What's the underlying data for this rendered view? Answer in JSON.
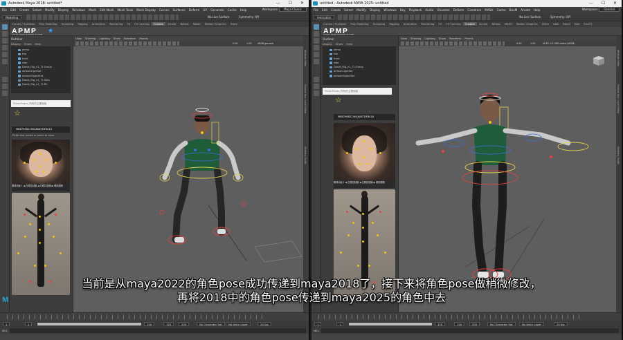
{
  "left_window": {
    "title": "Autodesk Maya 2018: untitled*",
    "menus": [
      "File",
      "Edit",
      "Create",
      "Select",
      "Modify",
      "Display",
      "Windows",
      "Mesh",
      "Edit Mesh",
      "Mesh Tools",
      "Mesh Display",
      "Curves",
      "Surfaces",
      "Deform",
      "UV",
      "Generate",
      "Cache",
      "Help"
    ],
    "workspace_label": "Workspace:",
    "workspace_value": "Maya Classic",
    "mode": "Modeling",
    "no_live": "No Live Surface",
    "symmetry": "Symmetry: Off",
    "shelf_tabs": [
      "Curves / Surfaces",
      "Poly Modeling",
      "Sculpting",
      "Rigging",
      "Animation",
      "Rendering",
      "FX",
      "FX Caching",
      "Custom",
      "Arnold",
      "Bifrost",
      "MASH",
      "Motion Graphics",
      "XGen"
    ],
    "active_shelf": "Custom",
    "outliner": {
      "title": "Outliner",
      "menu": [
        "Display",
        "Show",
        "Help"
      ],
      "rows": [
        "persp",
        "top",
        "front",
        "side",
        "Dandi_Rig_v1_71:Group",
        "defaultLightSet",
        "defaultObjectSet",
        "Dandi_Rig_v1_71:Sets",
        "Dandi_Rig_v1_71:Rh"
      ]
    },
    "picker_placeholder": "PickerPicker_所有的主要面板",
    "picker_bar": "MB87968225KAKA8TDFB418",
    "picker_desc": "Picker fast (select or select to close",
    "face_controls": "眼球动画  1   ◀ 左眼控制器  ◀ 右眼控制器  ▶ 眼睛跟随",
    "vp_menus": [
      "View",
      "Shading",
      "Lighting",
      "Show",
      "Renderer",
      "Panels"
    ],
    "vp_values": [
      "0.00",
      "1.00",
      "sRGB gamma"
    ],
    "range": {
      "start": "1",
      "frame": "1",
      "end_a": "120",
      "end_b": "120",
      "end_c": "200",
      "character": "No Character Set",
      "anim_layer": "No Anim Layer",
      "fps": "24 fps"
    },
    "mel": "MEL"
  },
  "right_window": {
    "title": "untitled - Autodesk MAYA 2025: untitled",
    "menus": [
      "File",
      "Edit",
      "Create",
      "Select",
      "Modify",
      "Display",
      "Windows",
      "Key",
      "Playback",
      "Audio",
      "Visualize",
      "Deform",
      "Constrain",
      "MASH",
      "Cache",
      "BeoM",
      "Arnold",
      "Help"
    ],
    "workspace_label": "Workspace:",
    "workspace_value": "General",
    "mode": "Animation",
    "no_live": "No Live Surface",
    "symmetry": "Symmetry: Off",
    "shelf_tabs": [
      "Curves / Surfaces",
      "Poly Modeling",
      "Sculpting",
      "Rigging",
      "Animation",
      "Rendering",
      "FX",
      "FX Caching",
      "Custom",
      "Arnold",
      "Bifrost",
      "MASH",
      "Motion Graphics",
      "XGen",
      "USD",
      "Bevel",
      "Edit",
      "FlexT3"
    ],
    "active_shelf": "Custom",
    "outliner": {
      "title": "Outliner",
      "menu": [
        "Display",
        "Show",
        "Help"
      ],
      "rows": [
        "persp",
        "top",
        "front",
        "side",
        "Dandi_Rig_v1_71:Group",
        "defaultLightSet",
        "defaultObjectSet"
      ]
    },
    "picker_placeholder": "PickerPicker_所有的主要面板",
    "picker_bar": "MB87968225KAKA8TDFB418",
    "picker_desc": "",
    "face_controls": "眼球动画  1   ◀ 左眼控制器  ◀ 右眼控制器  ▶ 眼睛跟随",
    "vp_menus": [
      "View",
      "Shading",
      "Lighting",
      "Show",
      "Renderer",
      "Panels"
    ],
    "vp_values": [
      "0.00",
      "1.00",
      "ACES 1.0 SDR-video (sRGB)"
    ],
    "camera_label": "persp",
    "range": {
      "start": "1",
      "frame": "1",
      "end_a": "120",
      "end_b": "120",
      "end_c": "200",
      "character": "No Character Set",
      "anim_layer": "No Anim Layer",
      "fps": "24 fps"
    },
    "mel": "MEL"
  },
  "subtitle": {
    "line1": "当前是从maya2022的角色pose成功传递到maya2018了，接下来将角色pose做稍微修改，",
    "line2": "再将2018中的角色pose传递到maya2025的角色中去"
  },
  "apmp": {
    "text": "APMP",
    "sub": "AGLEF  POSE  MIRROR  PICKER"
  },
  "colors": {
    "accent": "#5b8fb5",
    "maya_blue": "#25a4d2",
    "control_yellow": "#e8d24a",
    "control_red": "#e84040",
    "shirt": "#1f5c3a"
  },
  "icons": [
    "maya-logo",
    "select-tool-icon",
    "move-tool-icon",
    "rotate-tool-icon",
    "scale-tool-icon",
    "star-icon",
    "viewcube-icon"
  ]
}
